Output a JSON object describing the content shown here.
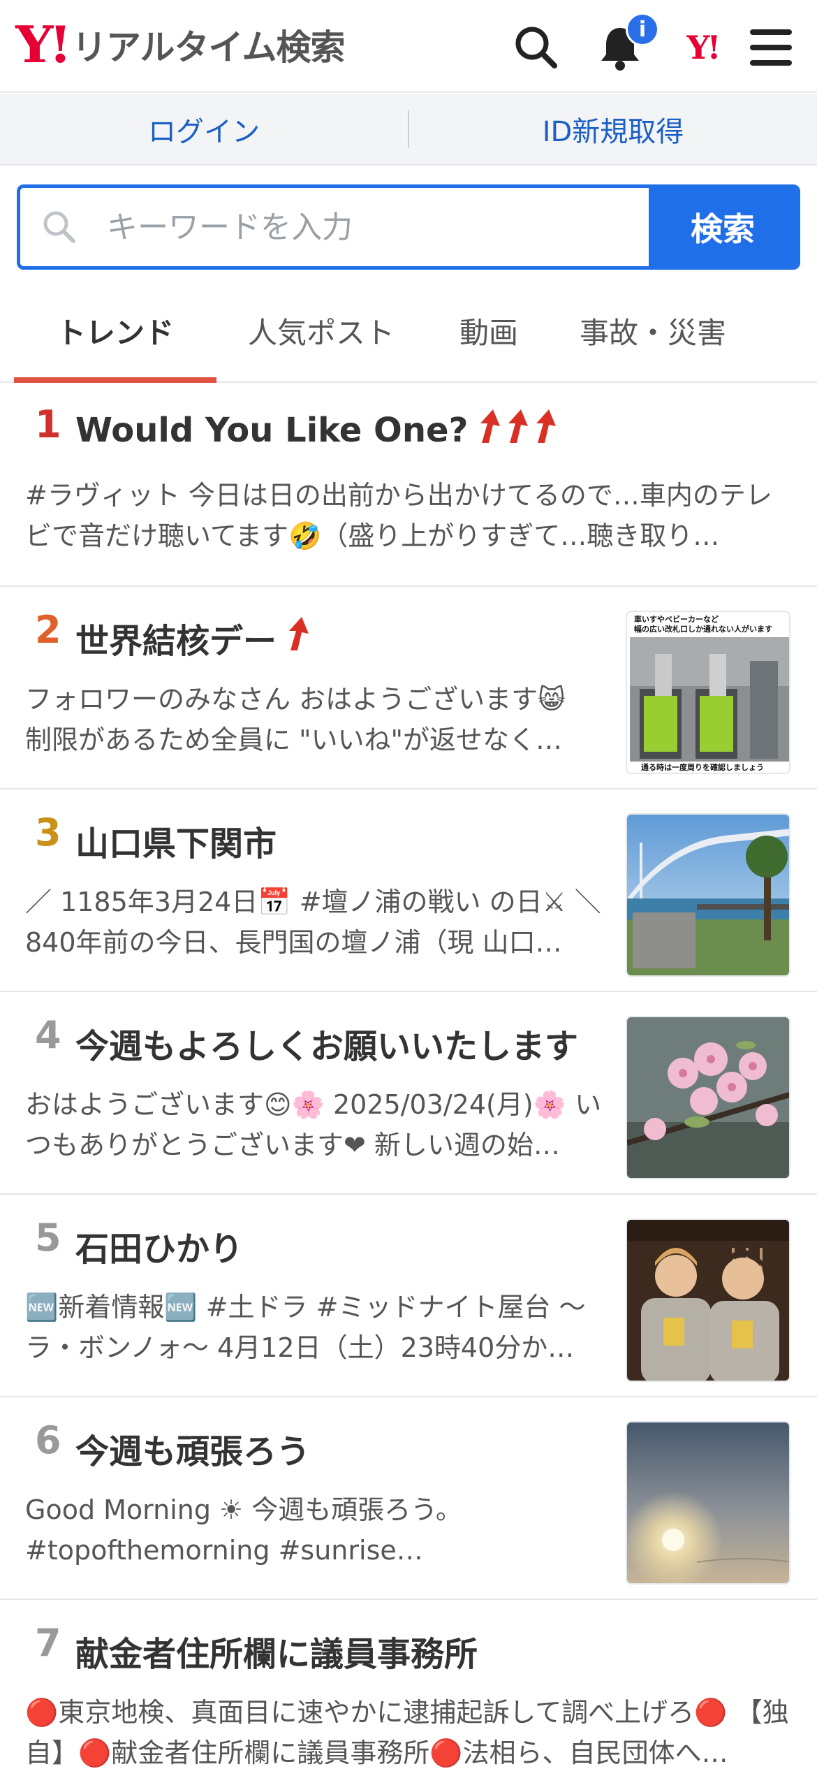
{
  "header": {
    "logo_mark": "Y!",
    "logo_text": "リアルタイム検索",
    "notification_badge": "i",
    "yj_mark": "Y!"
  },
  "account": {
    "login_label": "ログイン",
    "register_label": "ID新規取得"
  },
  "search": {
    "placeholder": "キーワードを入力",
    "button_label": "検索"
  },
  "tabs": [
    {
      "label": "トレンド",
      "active": true
    },
    {
      "label": "人気ポスト",
      "active": false
    },
    {
      "label": "動画",
      "active": false
    },
    {
      "label": "事故・災害",
      "active": false
    }
  ],
  "trends": [
    {
      "rank": "1",
      "title": "Would You Like One?",
      "arrows": 3,
      "rank_color": "#d0312d",
      "desc": "#ラヴィット 今日は日の出前から出かけてるので…車内のテレビで音だけ聴いてます🤣（盛り上がりすぎて…聴き取り…"
    },
    {
      "rank": "2",
      "title": "世界結核デー",
      "arrows": 1,
      "rank_color": "#e0622a",
      "desc": "フォロワーのみなさん おはようございます😸 制限があるため全員に \"いいね\"が返せなく…",
      "thumb": "station",
      "thumb_caption_top": "車いすやベビーカーなど\n幅の広い改札口しか通れない人がいます",
      "thumb_caption_bottom": "通る時は一度周りを確認しましょう"
    },
    {
      "rank": "3",
      "title": "山口県下関市",
      "arrows": 0,
      "rank_color": "#c9901a",
      "desc": "／ 1185年3月24日📅 #壇ノ浦の戦い の日⚔ ＼ 840年前の今日、長門国の壇ノ浦（現 山口…",
      "thumb": "bridge"
    },
    {
      "rank": "4",
      "title": "今週もよろしくお願いいたします",
      "arrows": 0,
      "rank_color": "#999999",
      "desc": "おはようございます😊🌸 2025/03/24(月)🌸 いつもありがとうございます❤ 新しい週の始…",
      "thumb": "blossom"
    },
    {
      "rank": "5",
      "title": "石田ひかり",
      "arrows": 0,
      "rank_color": "#999999",
      "desc": "🆕新着情報🆕 #土ドラ #ミッドナイト屋台 〜ラ・ボンノォ〜 4月12日（土）23時40分か…",
      "thumb": "people"
    },
    {
      "rank": "6",
      "title": "今週も頑張ろう",
      "arrows": 0,
      "rank_color": "#999999",
      "desc": "Good Morning ☀ 今週も頑張ろう。 #topofthemorning #sunrise…",
      "thumb": "sunrise"
    },
    {
      "rank": "7",
      "title": "献金者住所欄に議員事務所",
      "arrows": 0,
      "rank_color": "#999999",
      "desc": "🔴東京地検、真面目に速やかに逮捕起訴して調べ上げろ🔴 【独自】🔴献金者住所欄に議員事務所🔴法相ら、自民団体へ…"
    }
  ],
  "colors": {
    "accent_blue": "#1f6fe8",
    "tab_underline": "#e15240",
    "arrow_red": "#d93025"
  }
}
